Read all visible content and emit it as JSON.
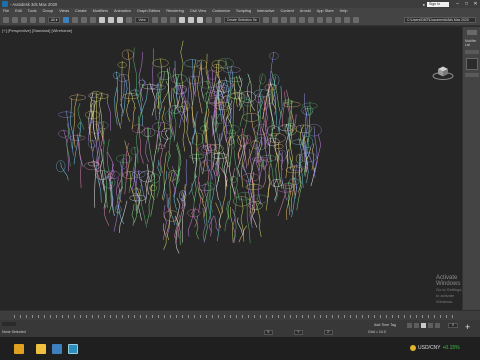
{
  "window": {
    "title": "- Autodesk 3ds Max 2020",
    "signin_label": "Sign In",
    "controls": [
      "–",
      "□",
      "✕"
    ]
  },
  "menu": {
    "items": [
      "File",
      "Edit",
      "Tools",
      "Group",
      "Views",
      "Create",
      "Modifiers",
      "Animation",
      "Graph Editors",
      "Rendering",
      "Civil View",
      "Customize",
      "Scripting",
      "Interactive",
      "Content",
      "Arnold",
      "App Store",
      "Help"
    ]
  },
  "toolbar": {
    "view_dropdown": "View",
    "selection_set": "Create Selection Se",
    "path_dropdown": "C:\\Users\\DMT\\Documents\\3ds Max 2020"
  },
  "viewport": {
    "label": "[+] [Perspective] [Standard] [Wireframe]",
    "watermark_title": "Activate Windows",
    "watermark_sub": "Go to Settings to activate Windows."
  },
  "command_panel": {
    "modifier_list_label": "Modifier List"
  },
  "status": {
    "selected": "None Selected",
    "grid": "Grid = 10.0",
    "add_time_tag": "Add Time Tag",
    "frame": "0",
    "x": "X:",
    "y": "Y:",
    "z": "Z:"
  },
  "taskbar": {
    "currency": "USD/CNY",
    "change": "+0.15%"
  },
  "colors": {
    "viewport_bg": "#262626",
    "ui_panel": "#444444",
    "taskbar": "#1f1f1f",
    "accent_blue": "#3d7fbf",
    "tray_green": "#3fc34c"
  }
}
